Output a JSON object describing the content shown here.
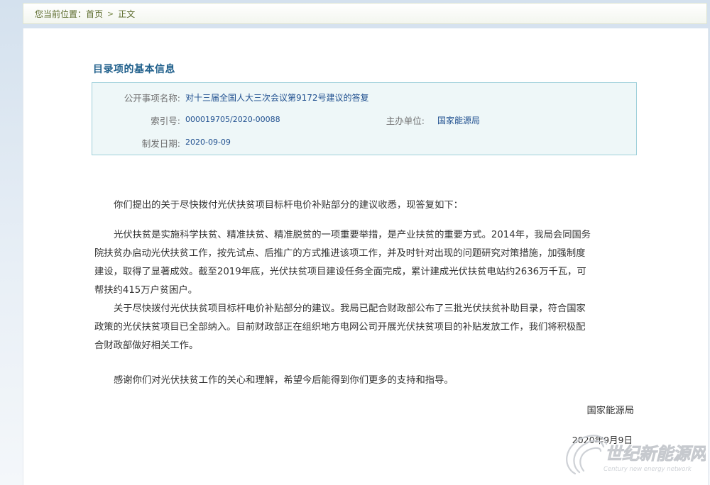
{
  "breadcrumb": {
    "prefix": "您当前位置：",
    "home": "首页",
    "separator": ">",
    "current": "正文"
  },
  "info": {
    "title": "目录项的基本信息",
    "fields": {
      "subject_label": "公开事项名称:",
      "subject_value": "对十三届全国人大三次会议第9172号建议的答复",
      "index_label": "索引号:",
      "index_value": "000019705/2020-00088",
      "org_label": "主办单位:",
      "org_value": "国家能源局",
      "date_label": "制发日期:",
      "date_value": "2020-09-09"
    }
  },
  "body": {
    "p1": "你们提出的关于尽快拨付光伏扶贫项目标杆电价补贴部分的建议收悉，现答复如下：",
    "p2": "光伏扶贫是实施科学扶贫、精准扶贫、精准脱贫的一项重要举措，是产业扶贫的重要方式。2014年，我局会同国务院扶贫办启动光伏扶贫工作，按先试点、后推广的方式推进该项工作，并及时针对出现的问题研究对策措施，加强制度建设，取得了显著成效。截至2019年底，光伏扶贫项目建设任务全面完成，累计建成光伏扶贫电站约2636万千瓦，可帮扶约415万户贫困户。",
    "p3": "关于尽快拨付光伏扶贫项目标杆电价补贴部分的建议。我局已配合财政部公布了三批光伏扶贫补助目录，符合国家政策的光伏扶贫项目已全部纳入。目前财政部正在组织地方电网公司开展光伏扶贫项目的补贴发放工作，我们将积极配合财政部做好相关工作。",
    "p4": "感谢你们对光伏扶贫工作的关心和理解，希望今后能得到你们更多的支持和指导。",
    "signature_org": "国家能源局",
    "signature_date": "2020年9月9日"
  },
  "watermark": {
    "name_cn": "世纪新能源网",
    "name_en": "Century new energy network",
    "icon": "swirl-logo-icon"
  },
  "colors": {
    "link_blue": "#1f4f8f",
    "title_blue": "#1f5f8b",
    "info_box_bg": "#eef7f8",
    "info_box_border": "#9fd0da",
    "breadcrumb_text": "#5a6a2a"
  }
}
